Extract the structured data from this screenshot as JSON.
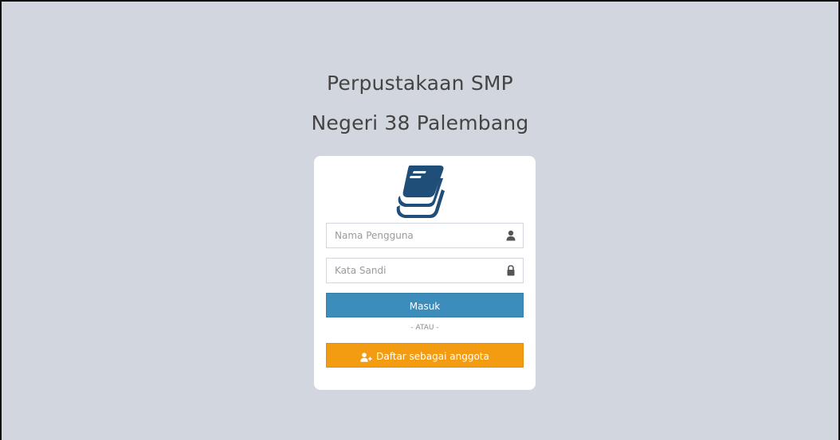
{
  "header": {
    "title_line1": "Perpustakaan SMP",
    "title_line2": "Negeri 38 Palembang"
  },
  "login_box": {
    "logo_icon": "book-stack-icon",
    "username": {
      "placeholder": "Nama Pengguna",
      "value": "",
      "icon": "user-icon"
    },
    "password": {
      "placeholder": "Kata Sandi",
      "value": "",
      "icon": "lock-icon"
    },
    "login_button_label": "Masuk",
    "separator_text": "- ATAU -",
    "register_button_label": "Daftar sebagai anggota",
    "register_icon": "user-plus-icon"
  },
  "colors": {
    "background": "#d2d6de",
    "primary_button": "#3c8dbc",
    "warning_button": "#f39c12",
    "logo": "#1f4e79"
  }
}
